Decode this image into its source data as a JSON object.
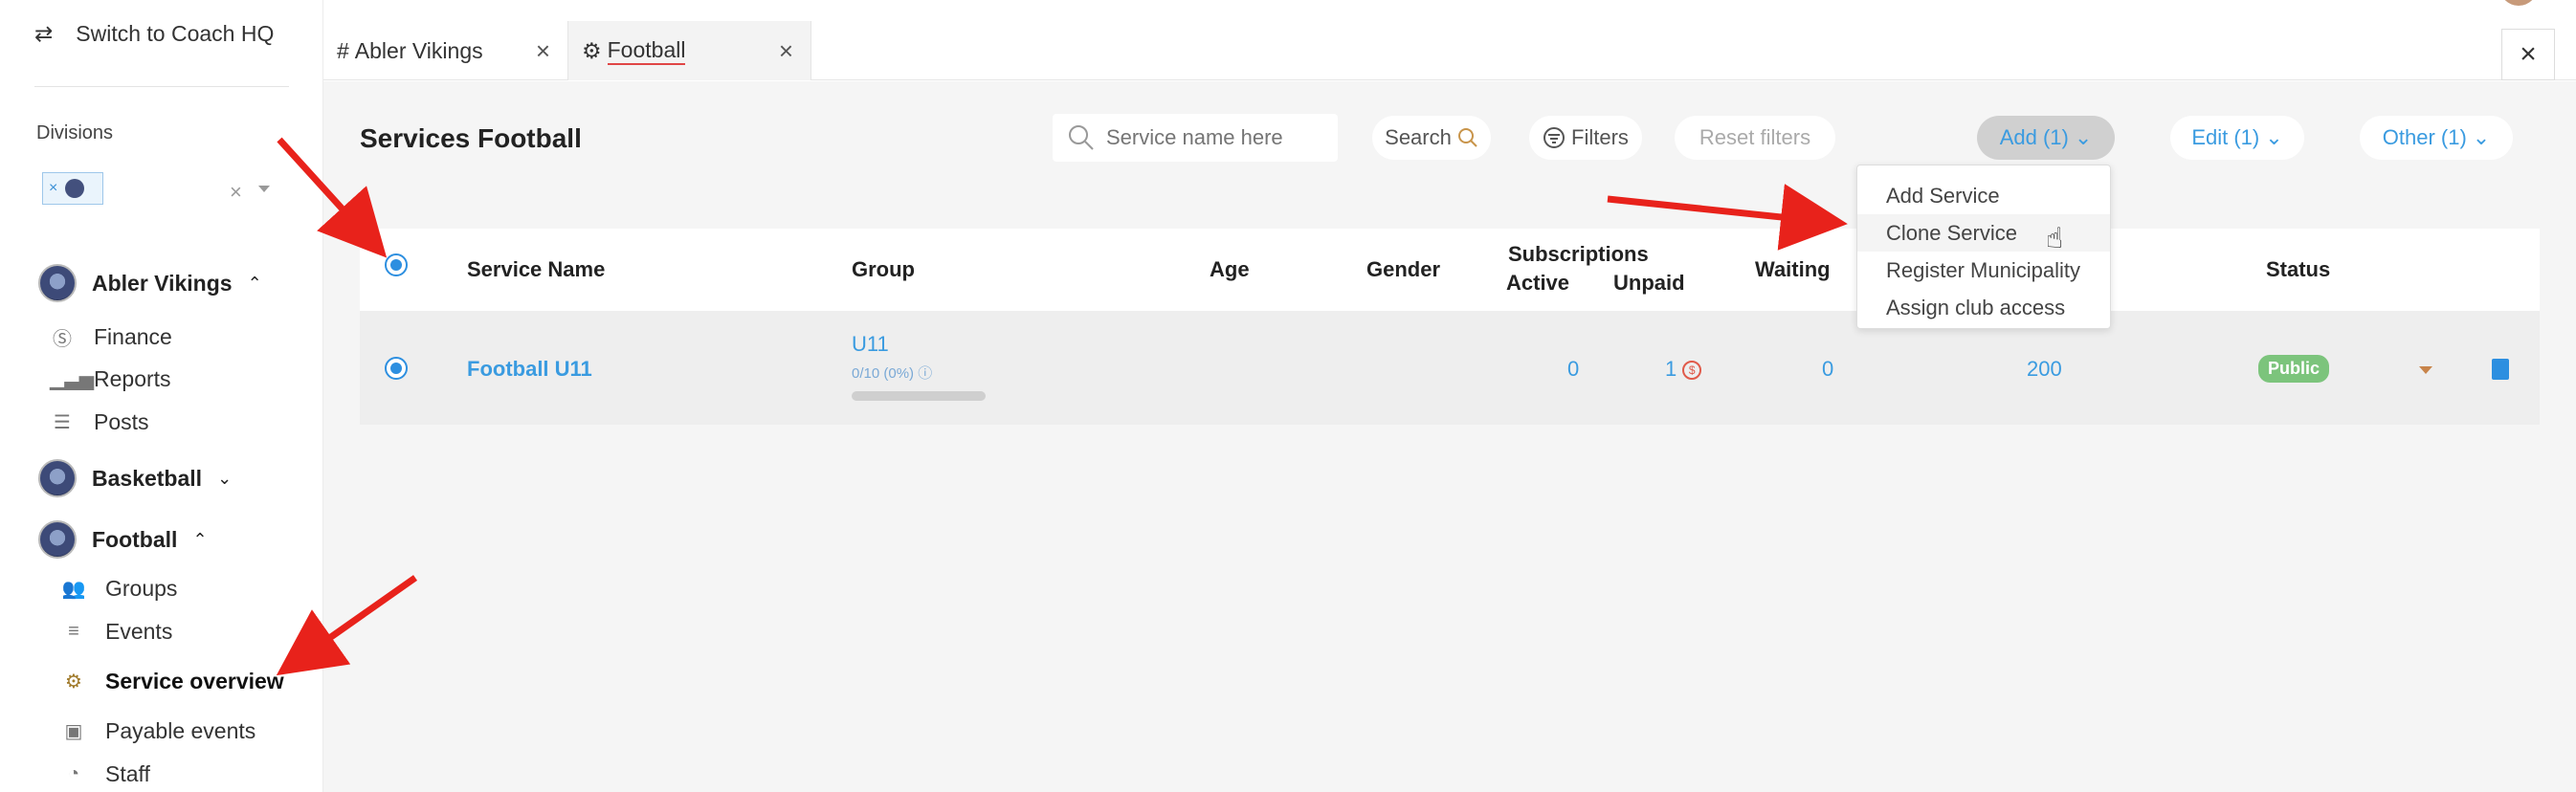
{
  "sidebar": {
    "switch_label": "Switch to Coach HQ",
    "divisions_label": "Divisions",
    "chip_remove": "×",
    "clear": "×",
    "teams": [
      {
        "name": "Abler Vikings",
        "chevron": "⌃"
      },
      {
        "name": "Basketball",
        "chevron": "⌄"
      },
      {
        "name": "Football",
        "chevron": "⌃"
      }
    ],
    "vikings_items": [
      "Finance",
      "Reports",
      "Posts"
    ],
    "football_items": [
      "Groups",
      "Events",
      "Service overview",
      "Payable events",
      "Staff"
    ]
  },
  "tabs": [
    {
      "label": "Abler Vikings",
      "prefix": "#",
      "close": "×"
    },
    {
      "label": "Football",
      "prefix": "⚙",
      "close": "×"
    }
  ],
  "panel_close": "×",
  "header": {
    "title": "Services Football",
    "search_placeholder": "Service name here",
    "search_label": "Search",
    "filters_label": "Filters",
    "reset_label": "Reset filters",
    "add_label": "Add (1)",
    "edit_label": "Edit (1)",
    "other_label": "Other (1)"
  },
  "table": {
    "headers": {
      "service_name": "Service Name",
      "group": "Group",
      "age": "Age",
      "gender": "Gender",
      "subscriptions": "Subscriptions",
      "active": "Active",
      "unpaid": "Unpaid",
      "waiting": "Waiting",
      "status": "Status"
    },
    "rows": [
      {
        "service_name": "Football U11",
        "group": "U11",
        "group_capacity": "0/10 (0%)",
        "group_fill": 0,
        "active": "0",
        "unpaid": "1",
        "waiting": "0",
        "price": "200",
        "status": "Public"
      }
    ]
  },
  "add_menu": {
    "items": [
      "Add Service",
      "Clone Service",
      "Register Municipality",
      "Assign club access"
    ],
    "hovered": "Clone Service"
  },
  "colors": {
    "accent": "#3a9be0",
    "status_public": "#7cc47c",
    "annotation_arrow": "#e8221b"
  }
}
